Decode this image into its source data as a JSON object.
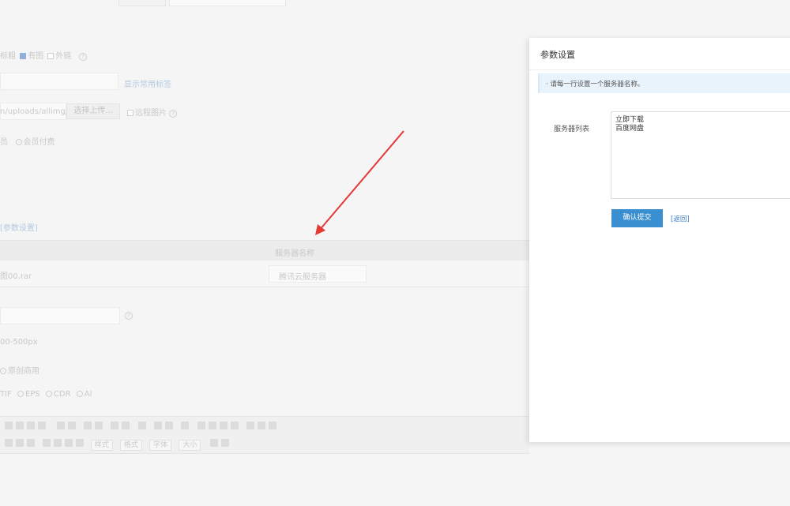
{
  "background_form": {
    "title_attr_label": "标粗",
    "has_image_label": "有图",
    "external_link_label": "外链",
    "common_tags_link": "显示常用标签",
    "upload_path": "n/uploads/allimg/2(",
    "upload_button": "选择上传...",
    "remote_image_label": "远程图片",
    "member_option_suffix": "员",
    "member_paid_option": "会员付费",
    "param_settings_link": "[参数设置]",
    "table_header_server": "服务器名称",
    "file_name": "图00.rar",
    "server_value": "腾讯云服务器",
    "size_text": "00-500px",
    "original_label": "原创商用",
    "formats": [
      "TIF",
      "EPS",
      "CDR",
      "AI"
    ],
    "editor_selects": [
      "样式",
      "格式",
      "字体",
      "大小"
    ]
  },
  "dialog": {
    "title": "参数设置",
    "tip": "· 请每一行设置一个服务器名称。",
    "server_list_label": "服务器列表",
    "server_list_value": "立即下载\n百度网盘",
    "confirm_button": "确认提交",
    "back_link": "[返回]",
    "accent_color": "#3a8fd0"
  }
}
